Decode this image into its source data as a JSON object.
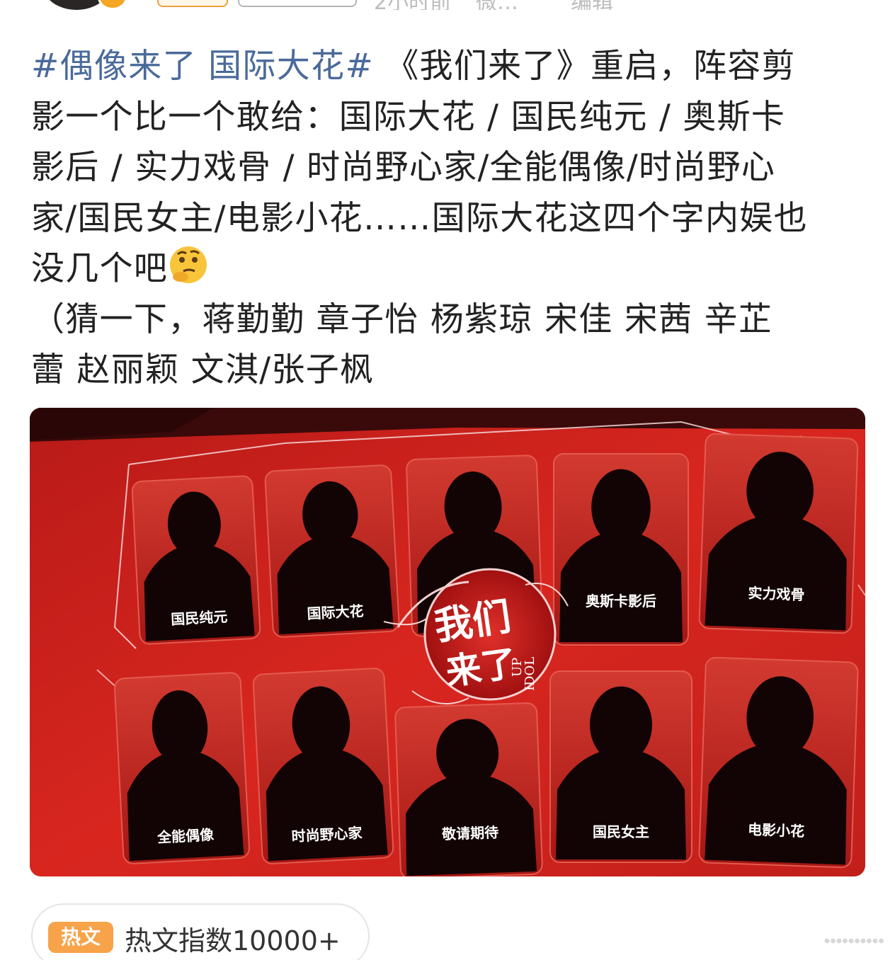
{
  "header": {
    "meta_time": "2小时前",
    "meta_source": "微…",
    "meta_edit": "编辑"
  },
  "post": {
    "hashtag": "#偶像来了 国际大花#",
    "lines": [
      " 《我们来了》重启，阵容剪",
      "影一个比一个敢给：国际大花 / 国民纯元 / 奥斯卡",
      "影后 / 实力戏骨 / 时尚野心家/全能偶像/时尚野心",
      "家/国民女主/电影小花……国际大花这四个字内娱也",
      "没几个吧",
      "（猜一下，蒋勤勤  章子怡  杨紫琼  宋佳 宋茜  辛芷",
      "蕾  赵丽颖  文淇/张子枫"
    ],
    "emoji": "thinking-face-emoji"
  },
  "image": {
    "logo_main": "我们",
    "logo_sub": "来了",
    "logo_en_1": "UP",
    "logo_en_2": "IDOL",
    "slots": [
      {
        "label": "国民纯元"
      },
      {
        "label": "国际大花"
      },
      {
        "label": ""
      },
      {
        "label": "奥斯卡影后"
      },
      {
        "label": "实力戏骨"
      },
      {
        "label": "全能偶像"
      },
      {
        "label": "时尚野心家"
      },
      {
        "label": "敬请期待"
      },
      {
        "label": "国民女主"
      },
      {
        "label": "电影小花"
      }
    ]
  },
  "footer": {
    "hot_tag": "热文",
    "hot_text": "热文指数10000+",
    "more_icon": "horizontal-dots-icon"
  },
  "colors": {
    "hashtag": "#4a6a9a",
    "image_bg": "#c8201c",
    "hot_tag_bg": "#f7a34a"
  }
}
